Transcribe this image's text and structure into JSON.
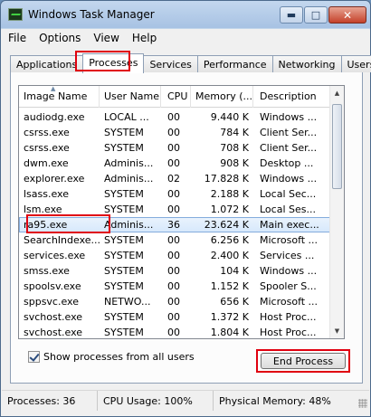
{
  "window": {
    "title": "Windows Task Manager"
  },
  "menu": [
    "File",
    "Options",
    "View",
    "Help"
  ],
  "tabs": [
    "Applications",
    "Processes",
    "Services",
    "Performance",
    "Networking",
    "Users"
  ],
  "active_tab": "Processes",
  "columns": {
    "image_name": "Image Name",
    "user_name": "User Name",
    "cpu": "CPU",
    "memory": "Memory (...",
    "description": "Description"
  },
  "processes": [
    {
      "name": "audiodg.exe",
      "user": "LOCAL ...",
      "cpu": "00",
      "mem": "9.440 K",
      "desc": "Windows ..."
    },
    {
      "name": "csrss.exe",
      "user": "SYSTEM",
      "cpu": "00",
      "mem": "784 K",
      "desc": "Client Ser..."
    },
    {
      "name": "csrss.exe",
      "user": "SYSTEM",
      "cpu": "00",
      "mem": "708 K",
      "desc": "Client Ser..."
    },
    {
      "name": "dwm.exe",
      "user": "Adminis...",
      "cpu": "00",
      "mem": "908 K",
      "desc": "Desktop ..."
    },
    {
      "name": "explorer.exe",
      "user": "Adminis...",
      "cpu": "02",
      "mem": "17.828 K",
      "desc": "Windows ..."
    },
    {
      "name": "lsass.exe",
      "user": "SYSTEM",
      "cpu": "00",
      "mem": "2.188 K",
      "desc": "Local Sec..."
    },
    {
      "name": "lsm.exe",
      "user": "SYSTEM",
      "cpu": "00",
      "mem": "1.072 K",
      "desc": "Local Ses..."
    },
    {
      "name": "ra95.exe",
      "user": "Adminis...",
      "cpu": "36",
      "mem": "23.624 K",
      "desc": "Main exec..."
    },
    {
      "name": "SearchIndexe...",
      "user": "SYSTEM",
      "cpu": "00",
      "mem": "6.256 K",
      "desc": "Microsoft ..."
    },
    {
      "name": "services.exe",
      "user": "SYSTEM",
      "cpu": "00",
      "mem": "2.400 K",
      "desc": "Services ..."
    },
    {
      "name": "smss.exe",
      "user": "SYSTEM",
      "cpu": "00",
      "mem": "104 K",
      "desc": "Windows ..."
    },
    {
      "name": "spoolsv.exe",
      "user": "SYSTEM",
      "cpu": "00",
      "mem": "1.152 K",
      "desc": "Spooler S..."
    },
    {
      "name": "sppsvc.exe",
      "user": "NETWO...",
      "cpu": "00",
      "mem": "656 K",
      "desc": "Microsoft ..."
    },
    {
      "name": "svchost.exe",
      "user": "SYSTEM",
      "cpu": "00",
      "mem": "1.372 K",
      "desc": "Host Proc..."
    },
    {
      "name": "svchost.exe",
      "user": "SYSTEM",
      "cpu": "00",
      "mem": "1.804 K",
      "desc": "Host Proc..."
    }
  ],
  "selected_process": "ra95.exe",
  "show_all_users": {
    "label": "Show processes from all users",
    "checked": true
  },
  "end_process_label": "End Process",
  "status": {
    "processes": "Processes: 36",
    "cpu_usage": "CPU Usage: 100%",
    "physical_memory": "Physical Memory: 48%"
  },
  "icons": [
    "task-manager-app-icon",
    "minimize-icon",
    "maximize-icon",
    "close-icon",
    "sort-up-icon",
    "scroll-up-icon",
    "scroll-down-icon",
    "checkmark-icon",
    "resize-grip-icon"
  ]
}
